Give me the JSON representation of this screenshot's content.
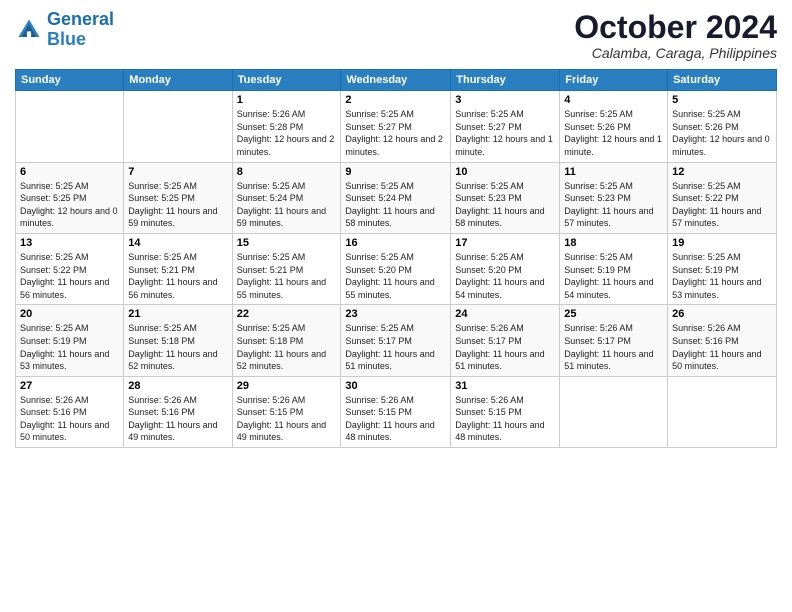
{
  "logo": {
    "line1": "General",
    "line2": "Blue"
  },
  "title": "October 2024",
  "location": "Calamba, Caraga, Philippines",
  "weekdays": [
    "Sunday",
    "Monday",
    "Tuesday",
    "Wednesday",
    "Thursday",
    "Friday",
    "Saturday"
  ],
  "weeks": [
    [
      {
        "day": "",
        "info": ""
      },
      {
        "day": "",
        "info": ""
      },
      {
        "day": "1",
        "info": "Sunrise: 5:26 AM\nSunset: 5:28 PM\nDaylight: 12 hours\nand 2 minutes."
      },
      {
        "day": "2",
        "info": "Sunrise: 5:25 AM\nSunset: 5:27 PM\nDaylight: 12 hours\nand 2 minutes."
      },
      {
        "day": "3",
        "info": "Sunrise: 5:25 AM\nSunset: 5:27 PM\nDaylight: 12 hours\nand 1 minute."
      },
      {
        "day": "4",
        "info": "Sunrise: 5:25 AM\nSunset: 5:26 PM\nDaylight: 12 hours\nand 1 minute."
      },
      {
        "day": "5",
        "info": "Sunrise: 5:25 AM\nSunset: 5:26 PM\nDaylight: 12 hours\nand 0 minutes."
      }
    ],
    [
      {
        "day": "6",
        "info": "Sunrise: 5:25 AM\nSunset: 5:25 PM\nDaylight: 12 hours\nand 0 minutes."
      },
      {
        "day": "7",
        "info": "Sunrise: 5:25 AM\nSunset: 5:25 PM\nDaylight: 11 hours\nand 59 minutes."
      },
      {
        "day": "8",
        "info": "Sunrise: 5:25 AM\nSunset: 5:24 PM\nDaylight: 11 hours\nand 59 minutes."
      },
      {
        "day": "9",
        "info": "Sunrise: 5:25 AM\nSunset: 5:24 PM\nDaylight: 11 hours\nand 58 minutes."
      },
      {
        "day": "10",
        "info": "Sunrise: 5:25 AM\nSunset: 5:23 PM\nDaylight: 11 hours\nand 58 minutes."
      },
      {
        "day": "11",
        "info": "Sunrise: 5:25 AM\nSunset: 5:23 PM\nDaylight: 11 hours\nand 57 minutes."
      },
      {
        "day": "12",
        "info": "Sunrise: 5:25 AM\nSunset: 5:22 PM\nDaylight: 11 hours\nand 57 minutes."
      }
    ],
    [
      {
        "day": "13",
        "info": "Sunrise: 5:25 AM\nSunset: 5:22 PM\nDaylight: 11 hours\nand 56 minutes."
      },
      {
        "day": "14",
        "info": "Sunrise: 5:25 AM\nSunset: 5:21 PM\nDaylight: 11 hours\nand 56 minutes."
      },
      {
        "day": "15",
        "info": "Sunrise: 5:25 AM\nSunset: 5:21 PM\nDaylight: 11 hours\nand 55 minutes."
      },
      {
        "day": "16",
        "info": "Sunrise: 5:25 AM\nSunset: 5:20 PM\nDaylight: 11 hours\nand 55 minutes."
      },
      {
        "day": "17",
        "info": "Sunrise: 5:25 AM\nSunset: 5:20 PM\nDaylight: 11 hours\nand 54 minutes."
      },
      {
        "day": "18",
        "info": "Sunrise: 5:25 AM\nSunset: 5:19 PM\nDaylight: 11 hours\nand 54 minutes."
      },
      {
        "day": "19",
        "info": "Sunrise: 5:25 AM\nSunset: 5:19 PM\nDaylight: 11 hours\nand 53 minutes."
      }
    ],
    [
      {
        "day": "20",
        "info": "Sunrise: 5:25 AM\nSunset: 5:19 PM\nDaylight: 11 hours\nand 53 minutes."
      },
      {
        "day": "21",
        "info": "Sunrise: 5:25 AM\nSunset: 5:18 PM\nDaylight: 11 hours\nand 52 minutes."
      },
      {
        "day": "22",
        "info": "Sunrise: 5:25 AM\nSunset: 5:18 PM\nDaylight: 11 hours\nand 52 minutes."
      },
      {
        "day": "23",
        "info": "Sunrise: 5:25 AM\nSunset: 5:17 PM\nDaylight: 11 hours\nand 51 minutes."
      },
      {
        "day": "24",
        "info": "Sunrise: 5:26 AM\nSunset: 5:17 PM\nDaylight: 11 hours\nand 51 minutes."
      },
      {
        "day": "25",
        "info": "Sunrise: 5:26 AM\nSunset: 5:17 PM\nDaylight: 11 hours\nand 51 minutes."
      },
      {
        "day": "26",
        "info": "Sunrise: 5:26 AM\nSunset: 5:16 PM\nDaylight: 11 hours\nand 50 minutes."
      }
    ],
    [
      {
        "day": "27",
        "info": "Sunrise: 5:26 AM\nSunset: 5:16 PM\nDaylight: 11 hours\nand 50 minutes."
      },
      {
        "day": "28",
        "info": "Sunrise: 5:26 AM\nSunset: 5:16 PM\nDaylight: 11 hours\nand 49 minutes."
      },
      {
        "day": "29",
        "info": "Sunrise: 5:26 AM\nSunset: 5:15 PM\nDaylight: 11 hours\nand 49 minutes."
      },
      {
        "day": "30",
        "info": "Sunrise: 5:26 AM\nSunset: 5:15 PM\nDaylight: 11 hours\nand 48 minutes."
      },
      {
        "day": "31",
        "info": "Sunrise: 5:26 AM\nSunset: 5:15 PM\nDaylight: 11 hours\nand 48 minutes."
      },
      {
        "day": "",
        "info": ""
      },
      {
        "day": "",
        "info": ""
      }
    ]
  ]
}
